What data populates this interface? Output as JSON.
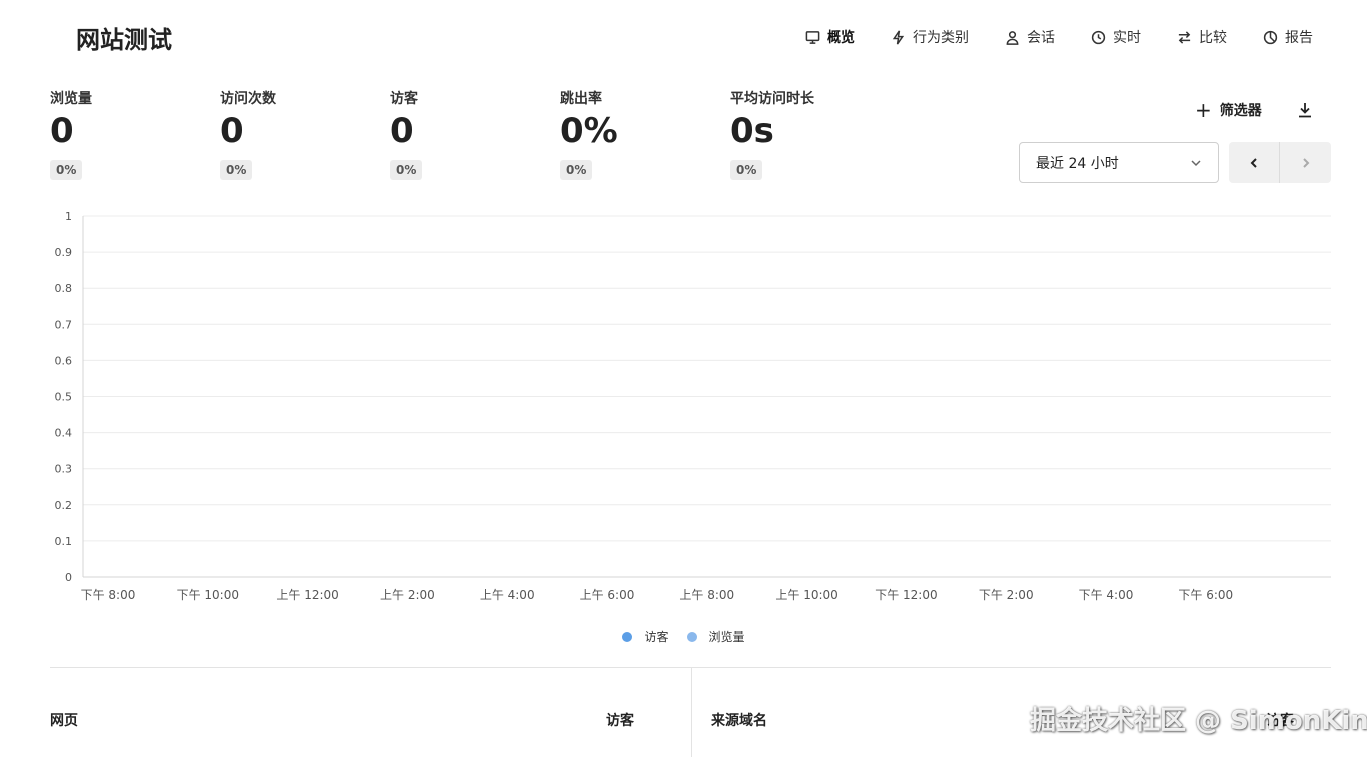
{
  "header": {
    "title": "网站测试",
    "nav": [
      {
        "label": "概览",
        "icon": "monitor-icon",
        "active": true
      },
      {
        "label": "行为类别",
        "icon": "lightning-icon",
        "active": false
      },
      {
        "label": "会话",
        "icon": "user-icon",
        "active": false
      },
      {
        "label": "实时",
        "icon": "clock-icon",
        "active": false
      },
      {
        "label": "比较",
        "icon": "swap-icon",
        "active": false
      },
      {
        "label": "报告",
        "icon": "pie-chart-icon",
        "active": false
      }
    ]
  },
  "metrics": [
    {
      "label": "浏览量",
      "value": "0",
      "change": "0%"
    },
    {
      "label": "访问次数",
      "value": "0",
      "change": "0%"
    },
    {
      "label": "访客",
      "value": "0",
      "change": "0%"
    },
    {
      "label": "跳出率",
      "value": "0%",
      "change": "0%"
    },
    {
      "label": "平均访问时长",
      "value": "0s",
      "change": "0%"
    }
  ],
  "toolbar": {
    "filter_label": "筛选器",
    "date_range": "最近 24 小时"
  },
  "chart_data": {
    "type": "bar",
    "x": [
      "下午 8:00",
      "下午 10:00",
      "上午 12:00",
      "上午 2:00",
      "上午 4:00",
      "上午 6:00",
      "上午 8:00",
      "上午 10:00",
      "下午 12:00",
      "下午 2:00",
      "下午 4:00",
      "下午 6:00"
    ],
    "y_ticks": [
      "0",
      "0.1",
      "0.2",
      "0.3",
      "0.4",
      "0.5",
      "0.6",
      "0.7",
      "0.8",
      "0.9",
      "1"
    ],
    "ylim": [
      0,
      1
    ],
    "grid": true,
    "legend_position": "bottom",
    "series": [
      {
        "name": "访客",
        "color": "#5b9ee6",
        "values": [
          0,
          0,
          0,
          0,
          0,
          0,
          0,
          0,
          0,
          0,
          0,
          0
        ]
      },
      {
        "name": "浏览量",
        "color": "#8ab8ec",
        "values": [
          0,
          0,
          0,
          0,
          0,
          0,
          0,
          0,
          0,
          0,
          0,
          0
        ]
      }
    ]
  },
  "tables": {
    "pages_header": "网页",
    "pages_visitors_header": "访客",
    "referrers_header": "来源域名",
    "referrers_visitors_header": "访客"
  },
  "watermark": "掘金技术社区 @ SimonKing"
}
